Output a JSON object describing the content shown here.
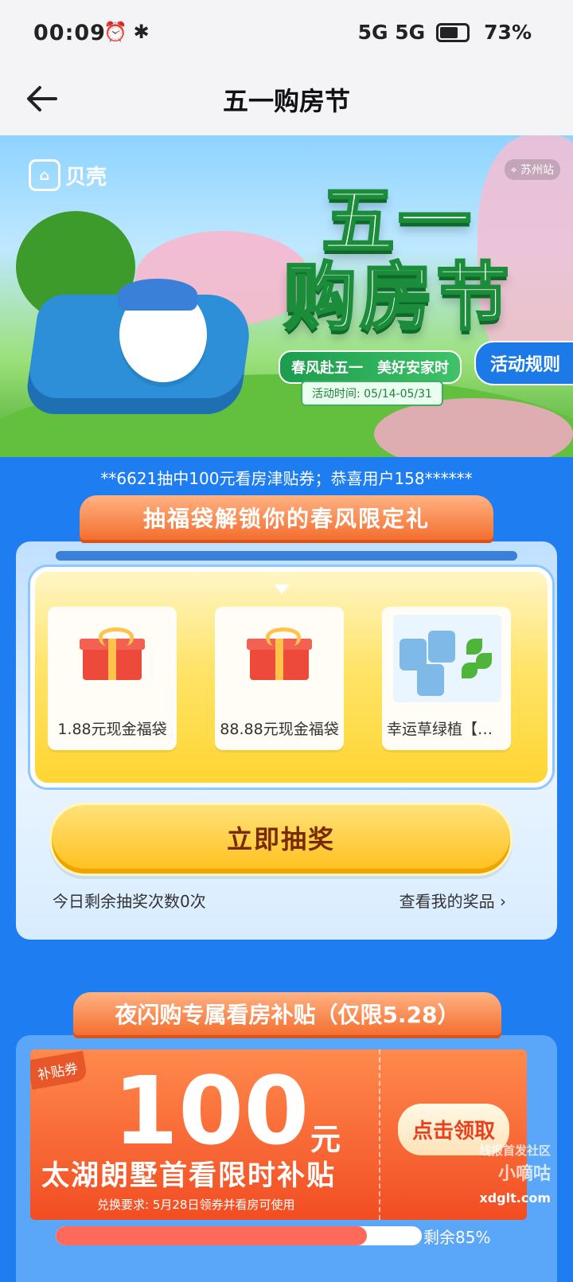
{
  "status_bar": {
    "time": "00:09",
    "left_icons": "⏰ ✱",
    "net": "5G 5G",
    "battery": "73%"
  },
  "nav": {
    "title": "五一购房节"
  },
  "banner": {
    "brand": "贝壳",
    "city": "苏州站",
    "title_line1": "五一",
    "title_line2": "购房节",
    "slogan": "春风赴五一　美好安家时",
    "event_time": "活动时间: 05/14-05/31",
    "rules_label": "活动规则"
  },
  "ticker": "**6621抽中100元看房津贴券；恭喜用户158******",
  "lottery": {
    "header": "抽福袋解锁你的春风限定礼",
    "prizes": [
      {
        "label": "1.88元现金福袋",
        "icon": "gift-icon"
      },
      {
        "label": "88.88元现金福袋",
        "icon": "gift-icon"
      },
      {
        "label": "幸运草绿植【运…",
        "icon": "plant-image"
      }
    ],
    "draw_label": "立即抽奖",
    "remaining": "今日剩余抽奖次数0次",
    "my_prizes": "查看我的奖品 ›"
  },
  "subsidy": {
    "header": "夜闪购专属看房补贴（仅限5.28）",
    "coupon": {
      "tag": "补贴券",
      "amount": "100",
      "unit": "元",
      "title": "太湖朗墅首看限时补贴",
      "requirement": "兑换要求: 5月28日领券并看房可使用",
      "claim_label": "点击领取"
    },
    "progress_text": "剩余85%",
    "progress_fraction": 0.85
  },
  "watermark": {
    "line1": "小嘀咕",
    "line2": "线报首发社区",
    "domain": "xdglt.com"
  },
  "colors": {
    "page_bg": "#1f7df2",
    "accent_orange": "#f36a2a",
    "gold": "#ffbf1a"
  }
}
